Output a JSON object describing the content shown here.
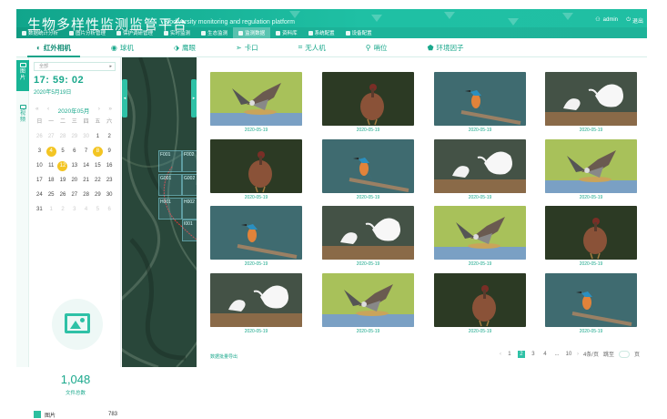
{
  "header": {
    "title": "生物多样性监测监管平台",
    "subtitle": "Biodiversity monitoring and regulation platform",
    "user": "admin",
    "logout": "退出"
  },
  "topnav": [
    {
      "label": "数据统计分析"
    },
    {
      "label": "图片分析管理"
    },
    {
      "label": "保护调研管理"
    },
    {
      "label": "实时监测"
    },
    {
      "label": "生态监测"
    },
    {
      "label": "监测数据",
      "active": true
    },
    {
      "label": "资料库"
    },
    {
      "label": "系统配置"
    },
    {
      "label": "设备配置"
    }
  ],
  "tabs": [
    {
      "label": "红外相机",
      "icon": "infrared-camera-icon",
      "glyph": "◐",
      "active": true
    },
    {
      "label": "球机",
      "icon": "dome-camera-icon",
      "glyph": "◉"
    },
    {
      "label": "鹰眼",
      "icon": "eagle-eye-icon",
      "glyph": "⬗"
    },
    {
      "label": "卡口",
      "icon": "checkpoint-icon",
      "glyph": "➣"
    },
    {
      "label": "无人机",
      "icon": "drone-icon",
      "glyph": "⌗"
    },
    {
      "label": "哨位",
      "icon": "sentry-icon",
      "glyph": "⚲"
    },
    {
      "label": "环境因子",
      "icon": "environment-icon",
      "glyph": "⬟"
    }
  ],
  "left_side": [
    {
      "label": "图片",
      "active": true
    },
    {
      "label": "视频",
      "active": false
    }
  ],
  "calendar": {
    "select_placeholder": "全部",
    "time": "17: 59: 02",
    "date": "2020年5月19日",
    "month_label": "2020年05月",
    "prev": "«",
    "prev_m": "‹",
    "next_m": "›",
    "next": "»",
    "weekdays": [
      "日",
      "一",
      "二",
      "三",
      "四",
      "五",
      "六"
    ],
    "days": [
      {
        "d": "26",
        "dim": true
      },
      {
        "d": "27",
        "dim": true
      },
      {
        "d": "28",
        "dim": true
      },
      {
        "d": "29",
        "dim": true
      },
      {
        "d": "30",
        "dim": true
      },
      {
        "d": "1"
      },
      {
        "d": "2"
      },
      {
        "d": "3"
      },
      {
        "d": "4",
        "mark": true
      },
      {
        "d": "5"
      },
      {
        "d": "6"
      },
      {
        "d": "7"
      },
      {
        "d": "8",
        "mark": true
      },
      {
        "d": "9"
      },
      {
        "d": "10"
      },
      {
        "d": "11"
      },
      {
        "d": "12",
        "mark": true
      },
      {
        "d": "13"
      },
      {
        "d": "14"
      },
      {
        "d": "15"
      },
      {
        "d": "16"
      },
      {
        "d": "17"
      },
      {
        "d": "18"
      },
      {
        "d": "19"
      },
      {
        "d": "20"
      },
      {
        "d": "21"
      },
      {
        "d": "22"
      },
      {
        "d": "23"
      },
      {
        "d": "24"
      },
      {
        "d": "25"
      },
      {
        "d": "26"
      },
      {
        "d": "27"
      },
      {
        "d": "28"
      },
      {
        "d": "29"
      },
      {
        "d": "30"
      },
      {
        "d": "31"
      },
      {
        "d": "1",
        "dim": true
      },
      {
        "d": "2",
        "dim": true
      },
      {
        "d": "3",
        "dim": true
      },
      {
        "d": "4",
        "dim": true
      },
      {
        "d": "5",
        "dim": true
      },
      {
        "d": "6",
        "dim": true
      }
    ],
    "file_count": "1,048",
    "file_count_label": "文件总数",
    "legend_label": "图片",
    "legend_value": "783"
  },
  "map": {
    "cells": [
      "F001",
      "F002",
      "G001",
      "G002",
      "H001",
      "H002",
      "I001"
    ]
  },
  "gallery": {
    "items": [
      {
        "date": "2020-05-19",
        "bird": "hawk"
      },
      {
        "date": "2020-05-19",
        "bird": "pheasant"
      },
      {
        "date": "2020-05-19",
        "bird": "kingfisher"
      },
      {
        "date": "2020-05-19",
        "bird": "egret"
      },
      {
        "date": "2020-05-19",
        "bird": "pheasant"
      },
      {
        "date": "2020-05-19",
        "bird": "kingfisher"
      },
      {
        "date": "2020-05-19",
        "bird": "egret"
      },
      {
        "date": "2020-05-19",
        "bird": "hawk"
      },
      {
        "date": "2020-05-19",
        "bird": "kingfisher"
      },
      {
        "date": "2020-05-19",
        "bird": "egret"
      },
      {
        "date": "2020-05-19",
        "bird": "hawk"
      },
      {
        "date": "2020-05-19",
        "bird": "pheasant"
      },
      {
        "date": "2020-05-19",
        "bird": "egret"
      },
      {
        "date": "2020-05-19",
        "bird": "hawk"
      },
      {
        "date": "2020-05-19",
        "bird": "pheasant"
      },
      {
        "date": "2020-05-19",
        "bird": "kingfisher"
      }
    ],
    "download_label": "数据批量导出",
    "pager": {
      "prev": "‹",
      "pages": [
        "1",
        "2",
        "3",
        "4",
        "...",
        "10"
      ],
      "active_index": 1,
      "next": "›",
      "per_page": "4条/页",
      "goto_label": "跳至",
      "page_suffix": "页"
    }
  }
}
